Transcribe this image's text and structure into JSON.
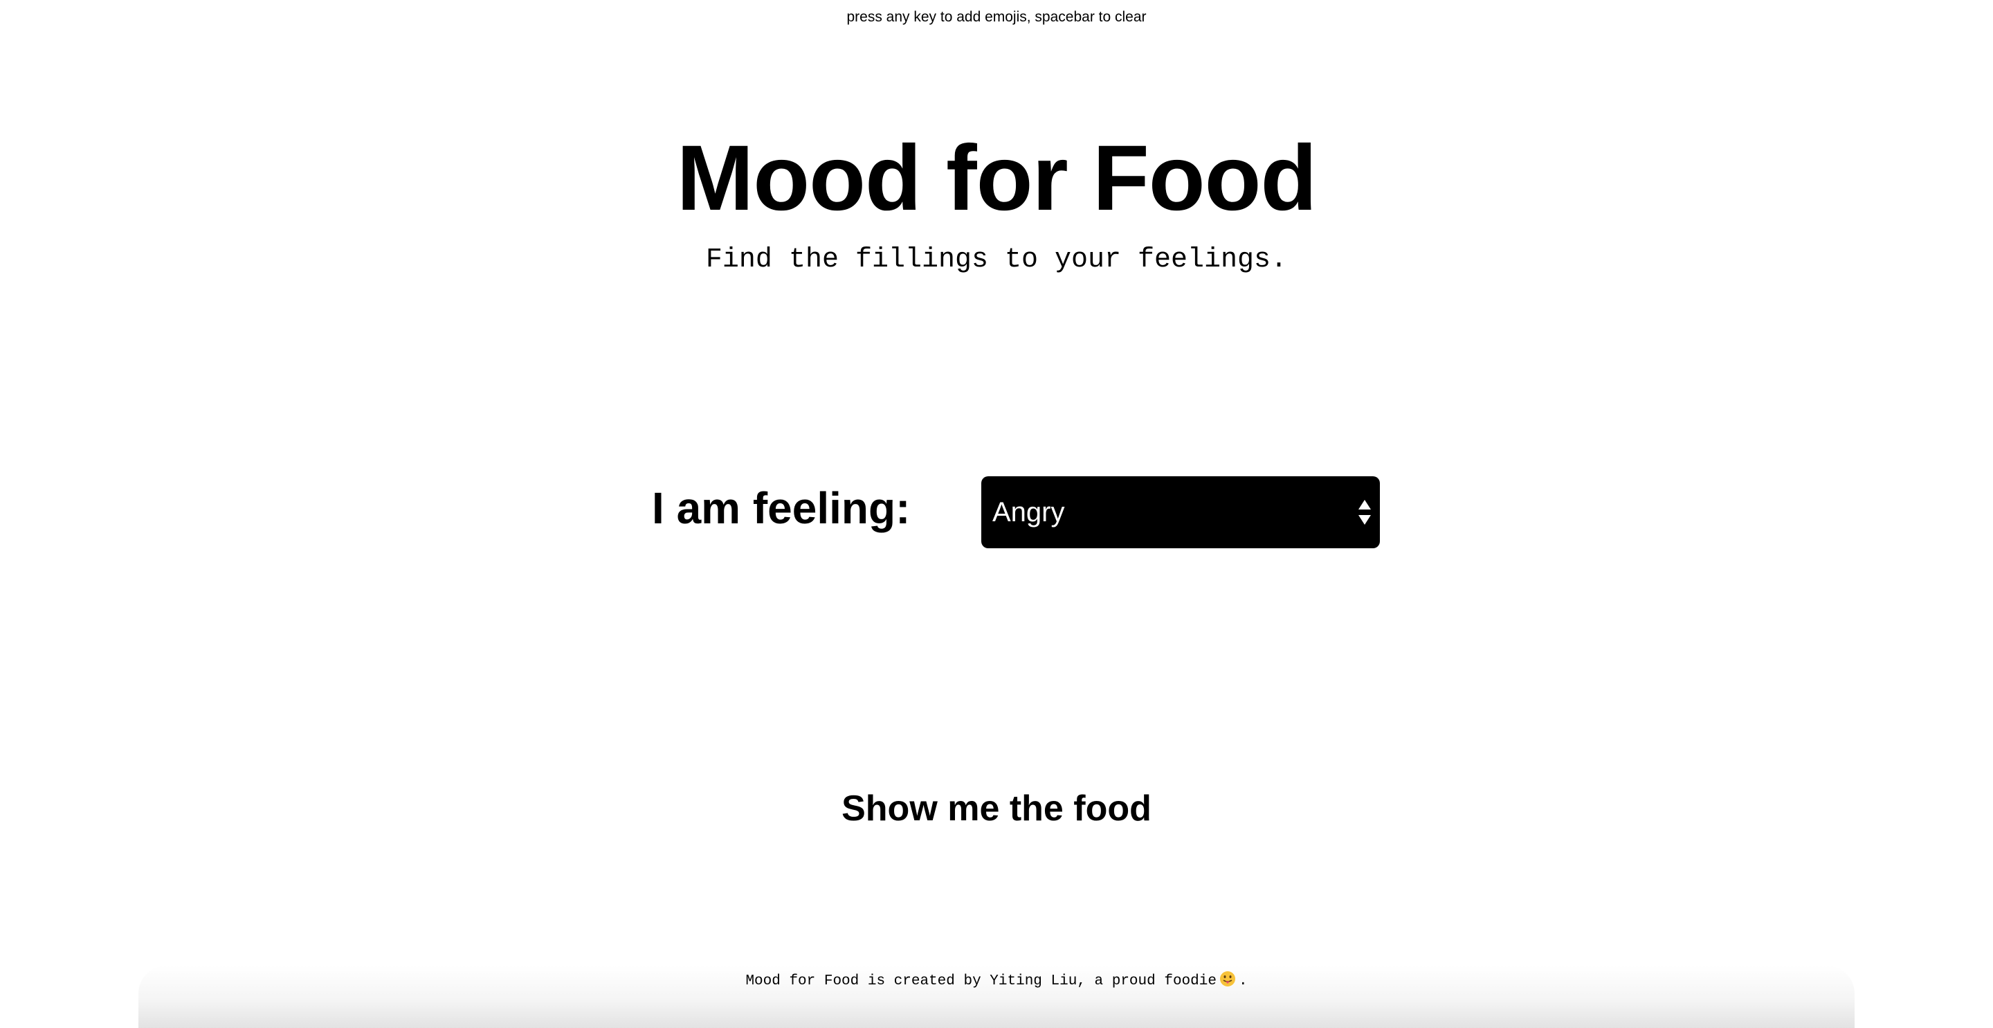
{
  "hint": "press any key to add emojis, spacebar to clear",
  "title": "Mood for Food",
  "subtitle": "Find the fillings to your feelings.",
  "feeling_label": "I am feeling:",
  "mood_select": {
    "selected": "Angry",
    "icon": "up-down-arrows-icon"
  },
  "show_button": "Show me the food",
  "footer": {
    "text_before": "Mood for Food is created by Yiting Liu, a proud foodie",
    "emoji": "tongue-out-face-icon",
    "text_after": "."
  },
  "colors": {
    "background": "#ffffff",
    "text": "#000000",
    "select_bg": "#000000",
    "select_text": "#ffffff"
  }
}
